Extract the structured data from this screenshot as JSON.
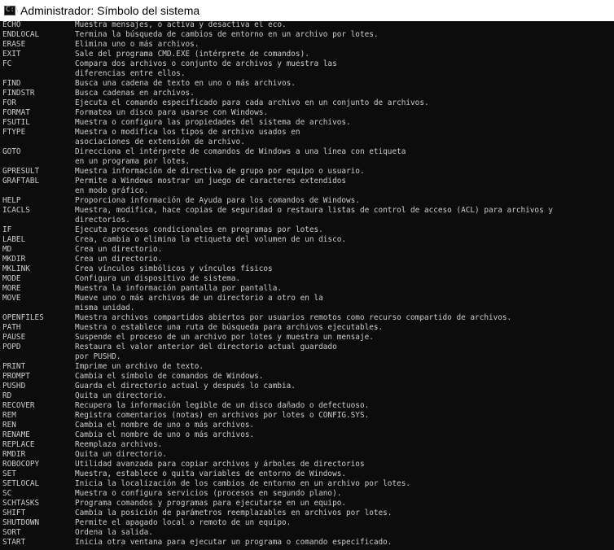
{
  "window": {
    "title": "Administrador: Símbolo del sistema",
    "icon": "cmd-console-icon",
    "icon_glyph": "C:\\"
  },
  "console": {
    "lines": [
      {
        "cmd": "ECHO",
        "desc": "Muestra mensajes, o activa y desactiva el eco."
      },
      {
        "cmd": "ENDLOCAL",
        "desc": "Termina la búsqueda de cambios de entorno en un archivo por lotes."
      },
      {
        "cmd": "ERASE",
        "desc": "Elimina uno o más archivos."
      },
      {
        "cmd": "EXIT",
        "desc": "Sale del programa CMD.EXE (intérprete de comandos)."
      },
      {
        "cmd": "FC",
        "desc": "Compara dos archivos o conjunto de archivos y muestra las"
      },
      {
        "cmd": "",
        "desc": "diferencias entre ellos."
      },
      {
        "cmd": "FIND",
        "desc": "Busca una cadena de texto en uno o más archivos."
      },
      {
        "cmd": "FINDSTR",
        "desc": "Busca cadenas en archivos."
      },
      {
        "cmd": "FOR",
        "desc": "Ejecuta el comando especificado para cada archivo en un conjunto de archivos."
      },
      {
        "cmd": "FORMAT",
        "desc": "Formatea un disco para usarse con Windows."
      },
      {
        "cmd": "FSUTIL",
        "desc": "Muestra o configura las propiedades del sistema de archivos."
      },
      {
        "cmd": "FTYPE",
        "desc": "Muestra o modifica los tipos de archivo usados en"
      },
      {
        "cmd": "",
        "desc": "asociaciones de extensión de archivo."
      },
      {
        "cmd": "GOTO",
        "desc": "Direcciona el intérprete de comandos de Windows a una línea con etiqueta"
      },
      {
        "cmd": "",
        "desc": "en un programa por lotes."
      },
      {
        "cmd": "GPRESULT",
        "desc": "Muestra información de directiva de grupo por equipo o usuario."
      },
      {
        "cmd": "GRAFTABL",
        "desc": "Permite a Windows mostrar un juego de caracteres extendidos"
      },
      {
        "cmd": "",
        "desc": "en modo gráfico."
      },
      {
        "cmd": "HELP",
        "desc": "Proporciona información de Ayuda para los comandos de Windows."
      },
      {
        "cmd": "ICACLS",
        "desc": "Muestra, modifica, hace copias de seguridad o restaura listas de control de acceso (ACL) para archivos y"
      },
      {
        "cmd": "",
        "desc": "directorios."
      },
      {
        "cmd": "IF",
        "desc": "Ejecuta procesos condicionales en programas por lotes."
      },
      {
        "cmd": "LABEL",
        "desc": "Crea, cambia o elimina la etiqueta del volumen de un disco."
      },
      {
        "cmd": "MD",
        "desc": "Crea un directorio."
      },
      {
        "cmd": "MKDIR",
        "desc": "Crea un directorio."
      },
      {
        "cmd": "MKLINK",
        "desc": "Crea vínculos simbólicos y vínculos físicos"
      },
      {
        "cmd": "MODE",
        "desc": "Configura un dispositivo de sistema."
      },
      {
        "cmd": "MORE",
        "desc": "Muestra la información pantalla por pantalla."
      },
      {
        "cmd": "MOVE",
        "desc": "Mueve uno o más archivos de un directorio a otro en la"
      },
      {
        "cmd": "",
        "desc": "misma unidad."
      },
      {
        "cmd": "OPENFILES",
        "desc": "Muestra archivos compartidos abiertos por usuarios remotos como recurso compartido de archivos."
      },
      {
        "cmd": "PATH",
        "desc": "Muestra o establece una ruta de búsqueda para archivos ejecutables."
      },
      {
        "cmd": "PAUSE",
        "desc": "Suspende el proceso de un archivo por lotes y muestra un mensaje."
      },
      {
        "cmd": "POPD",
        "desc": "Restaura el valor anterior del directorio actual guardado"
      },
      {
        "cmd": "",
        "desc": "por PUSHD."
      },
      {
        "cmd": "PRINT",
        "desc": "Imprime un archivo de texto."
      },
      {
        "cmd": "PROMPT",
        "desc": "Cambia el símbolo de comandos de Windows."
      },
      {
        "cmd": "PUSHD",
        "desc": "Guarda el directorio actual y después lo cambia."
      },
      {
        "cmd": "RD",
        "desc": "Quita un directorio."
      },
      {
        "cmd": "RECOVER",
        "desc": "Recupera la información legible de un disco dañado o defectuoso."
      },
      {
        "cmd": "REM",
        "desc": "Registra comentarios (notas) en archivos por lotes o CONFIG.SYS."
      },
      {
        "cmd": "REN",
        "desc": "Cambia el nombre de uno o más archivos."
      },
      {
        "cmd": "RENAME",
        "desc": "Cambia el nombre de uno o más archivos."
      },
      {
        "cmd": "REPLACE",
        "desc": "Reemplaza archivos."
      },
      {
        "cmd": "RMDIR",
        "desc": "Quita un directorio."
      },
      {
        "cmd": "ROBOCOPY",
        "desc": "Utilidad avanzada para copiar archivos y árboles de directorios"
      },
      {
        "cmd": "SET",
        "desc": "Muestra, establece o quita variables de entorno de Windows."
      },
      {
        "cmd": "SETLOCAL",
        "desc": "Inicia la localización de los cambios de entorno en un archivo por lotes."
      },
      {
        "cmd": "SC",
        "desc": "Muestra o configura servicios (procesos en segundo plano)."
      },
      {
        "cmd": "SCHTASKS",
        "desc": "Programa comandos y programas para ejecutarse en un equipo."
      },
      {
        "cmd": "SHIFT",
        "desc": "Cambia la posición de parámetros reemplazables en archivos por lotes."
      },
      {
        "cmd": "SHUTDOWN",
        "desc": "Permite el apagado local o remoto de un equipo."
      },
      {
        "cmd": "SORT",
        "desc": "Ordena la salida."
      },
      {
        "cmd": "START",
        "desc": "Inicia otra ventana para ejecutar un programa o comando especificado."
      }
    ]
  }
}
